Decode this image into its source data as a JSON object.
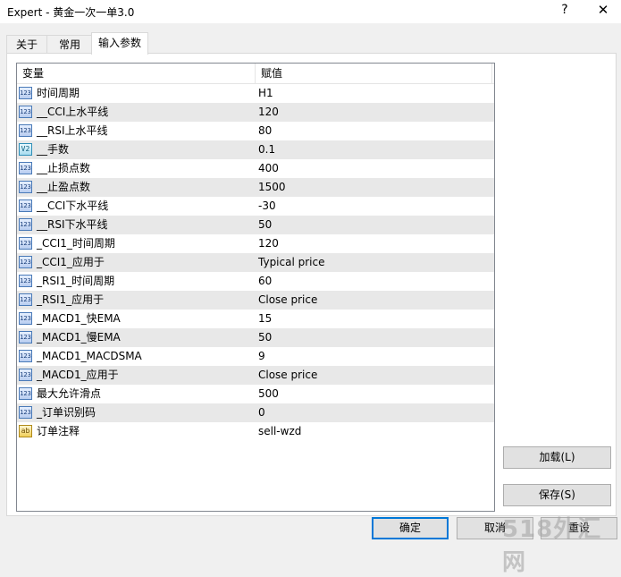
{
  "window": {
    "title": "Expert - 黄金一次一单3.0",
    "help": "?",
    "close": "✕"
  },
  "tabs": [
    {
      "label": "关于"
    },
    {
      "label": "常用"
    },
    {
      "label": "输入参数"
    }
  ],
  "grid": {
    "header_variable": "变量",
    "header_value": "赋值",
    "rows": [
      {
        "icon": "123",
        "name": "时间周期",
        "value": "H1"
      },
      {
        "icon": "123",
        "name": "__CCI上水平线",
        "value": "120"
      },
      {
        "icon": "123",
        "name": "__RSI上水平线",
        "value": "80"
      },
      {
        "icon": "V2",
        "name": "__手数",
        "value": "0.1"
      },
      {
        "icon": "123",
        "name": "__止损点数",
        "value": "400"
      },
      {
        "icon": "123",
        "name": "__止盈点数",
        "value": "1500"
      },
      {
        "icon": "123",
        "name": "__CCI下水平线",
        "value": "-30"
      },
      {
        "icon": "123",
        "name": "__RSI下水平线",
        "value": "50"
      },
      {
        "icon": "123",
        "name": "_CCI1_时间周期",
        "value": "120"
      },
      {
        "icon": "123",
        "name": "_CCI1_应用于",
        "value": "Typical price"
      },
      {
        "icon": "123",
        "name": "_RSI1_时间周期",
        "value": "60"
      },
      {
        "icon": "123",
        "name": "_RSI1_应用于",
        "value": "Close price"
      },
      {
        "icon": "123",
        "name": "_MACD1_快EMA",
        "value": "15"
      },
      {
        "icon": "123",
        "name": "_MACD1_慢EMA",
        "value": "50"
      },
      {
        "icon": "123",
        "name": "_MACD1_MACDSMA",
        "value": "9"
      },
      {
        "icon": "123",
        "name": "_MACD1_应用于",
        "value": "Close price"
      },
      {
        "icon": "123",
        "name": "最大允许滑点",
        "value": "500"
      },
      {
        "icon": "123",
        "name": "_订单识别码",
        "value": "0"
      },
      {
        "icon": "ab",
        "name": "订单注释",
        "value": "sell-wzd"
      }
    ]
  },
  "buttons": {
    "load": "加载(L)",
    "save": "保存(S)",
    "ok": "确定",
    "cancel": "取消",
    "reset": "重设"
  },
  "watermark": "518外汇网"
}
